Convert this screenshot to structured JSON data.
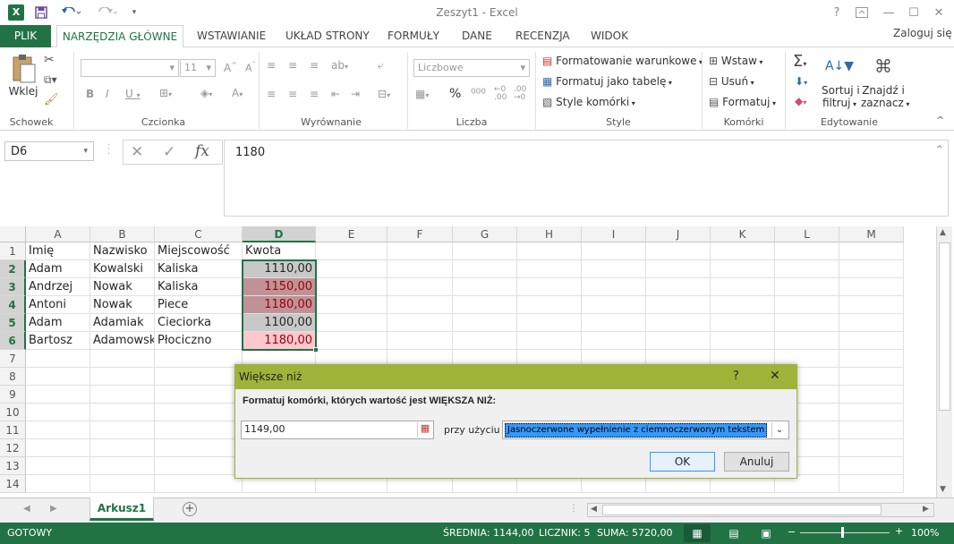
{
  "window": {
    "title": "Zeszyt1 - Excel",
    "help_icon": "?",
    "restore_ribbon_icon": "ribbon-display-icon",
    "minimize_icon": "—",
    "maximize_icon": "☐",
    "close_icon": "✕"
  },
  "tabs": {
    "file": "PLIK",
    "items": [
      "NARZĘDZIA GŁÓWNE",
      "WSTAWIANIE",
      "UKŁAD STRONY",
      "FORMUŁY",
      "DANE",
      "RECENZJA",
      "WIDOK"
    ],
    "active": "NARZĘDZIA GŁÓWNE",
    "signin": "Zaloguj się"
  },
  "ribbon": {
    "groups": {
      "clipboard": "Schowek",
      "font": "Czcionka",
      "alignment": "Wyrównanie",
      "number": "Liczba",
      "styles": "Style",
      "cells": "Komórki",
      "editing": "Edytowanie"
    },
    "paste": "Wklej",
    "font_size": "11",
    "number_format": "Liczbowe",
    "percent": "%",
    "cond_format": "Formatowanie warunkowe",
    "format_table": "Formatuj jako tabelę",
    "cell_styles": "Style komórki",
    "insert": "Wstaw",
    "delete": "Usuń",
    "format": "Formatuj",
    "sort": "Sortuj i",
    "sort2": "filtruj",
    "find": "Znajdź i",
    "find2": "zaznacz"
  },
  "formula_bar": {
    "name_box": "D6",
    "fx": "fx",
    "value": "1180"
  },
  "sheet": {
    "columns": [
      "A",
      "B",
      "C",
      "D",
      "E",
      "F",
      "G",
      "H",
      "I",
      "J",
      "K",
      "L",
      "M"
    ],
    "rows": [
      "1",
      "2",
      "3",
      "4",
      "5",
      "6",
      "7",
      "8",
      "9",
      "10",
      "11",
      "12",
      "13",
      "14"
    ],
    "data": [
      [
        "Imię",
        "Nazwisko",
        "Miejscowość",
        "Kwota"
      ],
      [
        "Adam",
        "Kowalski",
        "Kaliska",
        "1110,00"
      ],
      [
        "Andrzej",
        "Nowak",
        "Kaliska",
        "1150,00"
      ],
      [
        "Antoni",
        "Nowak",
        "Piece",
        "1180,00"
      ],
      [
        "Adam",
        "Adamiak",
        "Cieciorka",
        "1100,00"
      ],
      [
        "Bartosz",
        "Adamowski",
        "Płociczno",
        "1180,00"
      ]
    ],
    "highlight_colors": {
      "neutral": "#c8c8c8",
      "preview": "#c09296",
      "light_red": "#ffc7ce",
      "dark_red_text": "#9c0006"
    }
  },
  "sheet_tabs": {
    "active": "Arkusz1",
    "add": "+"
  },
  "status": {
    "ready": "GOTOWY",
    "average": "ŚREDNIA: 1144,00",
    "count": "LICZNIK: 5",
    "sum": "SUMA: 5720,00",
    "zoom": "100%"
  },
  "dialog": {
    "title": "Większe niż",
    "help": "?",
    "close": "✕",
    "instruction": "Formatuj komórki, których wartość jest WIĘKSZA NIŻ:",
    "value": "1149,00",
    "with_label": "przy użyciu",
    "format_option": "Jasnoczerwone wypełnienie z ciemnoczerwonym tekstem",
    "ok": "OK",
    "cancel": "Anuluj"
  },
  "colors": {
    "excel_green": "#217346",
    "dialog_accent": "#9fb338"
  }
}
